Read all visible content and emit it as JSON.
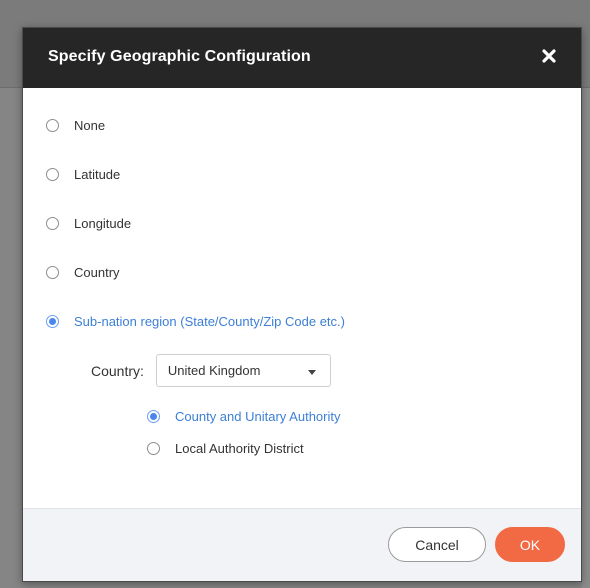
{
  "dialog": {
    "title": "Specify Geographic Configuration",
    "close_icon": "close-icon"
  },
  "options": [
    {
      "label": "None",
      "checked": false
    },
    {
      "label": "Latitude",
      "checked": false
    },
    {
      "label": "Longitude",
      "checked": false
    },
    {
      "label": "Country",
      "checked": false
    },
    {
      "label": "Sub-nation region (State/County/Zip Code etc.)",
      "checked": true
    }
  ],
  "country": {
    "label": "Country:",
    "selected": "United Kingdom"
  },
  "sub_options": [
    {
      "label": "County and Unitary Authority",
      "checked": true
    },
    {
      "label": "Local Authority District",
      "checked": false
    }
  ],
  "footer": {
    "cancel_label": "Cancel",
    "ok_label": "OK"
  },
  "colors": {
    "header_bg": "#262626",
    "accent_blue": "#4a86ec",
    "ok_orange": "#f26a44"
  }
}
